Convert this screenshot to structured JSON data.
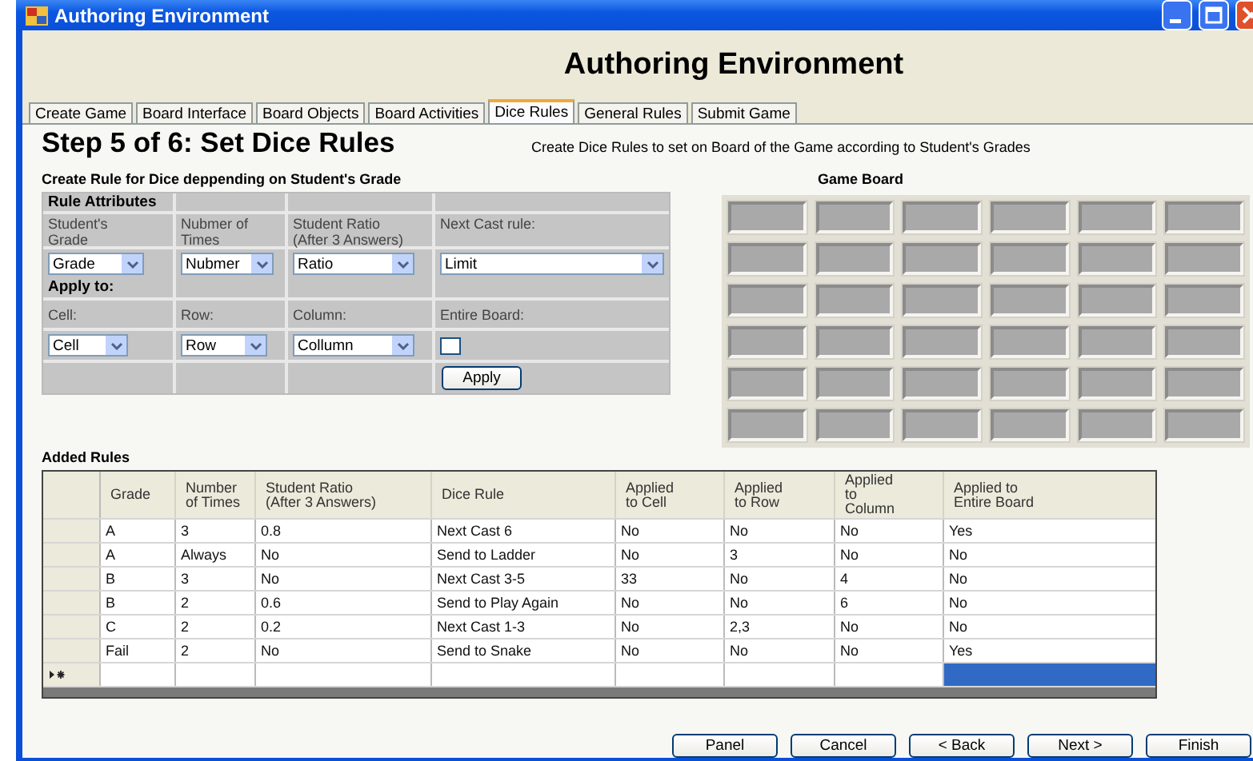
{
  "window": {
    "title": "Authoring Environment"
  },
  "header": "Authoring Environment",
  "tabs": [
    {
      "label": "Create Game",
      "selected": false
    },
    {
      "label": "Board Interface",
      "selected": false
    },
    {
      "label": "Board Objects",
      "selected": false
    },
    {
      "label": "Board Activities",
      "selected": false
    },
    {
      "label": "Dice Rules",
      "selected": true
    },
    {
      "label": "General Rules",
      "selected": false
    },
    {
      "label": "Submit Game",
      "selected": false
    }
  ],
  "step_title": "Step 5 of 6: Set Dice Rules",
  "description": "Create Dice Rules to set on Board of the Game according to Student's Grades",
  "rule_form": {
    "title": "Create Rule for Dice deppending on Student's Grade",
    "attributes_heading": "Rule Attributes",
    "attribute_labels": [
      "Student's\nGrade",
      "Nubmer of\nTimes",
      "Student Ratio\n(After 3 Answers)",
      "Next Cast rule:"
    ],
    "attribute_dropdowns": [
      "Grade",
      "Nubmer",
      "Ratio",
      "Limit"
    ],
    "apply_heading": "Apply to:",
    "apply_labels": [
      "Cell:",
      "Row:",
      "Column:",
      "Entire Board:"
    ],
    "apply_dropdowns": [
      "Cell",
      "Row",
      "Collumn"
    ],
    "entire_board_checked": false,
    "apply_button": "Apply"
  },
  "game_board": {
    "title": "Game Board"
  },
  "added_rules": {
    "title": "Added Rules",
    "columns": [
      "Grade",
      "Number\nof Times",
      "Student Ratio\n(After 3 Answers)",
      "Dice Rule",
      "Applied\nto Cell",
      "Applied\nto Row",
      "Applied\nto\nColumn",
      "Applied to\nEntire Board"
    ],
    "rows": [
      [
        "A",
        "3",
        "0.8",
        "Next Cast 6",
        "No",
        "No",
        "No",
        "Yes"
      ],
      [
        "A",
        "Always",
        "No",
        "Send to Ladder",
        "No",
        "3",
        "No",
        "No"
      ],
      [
        "B",
        "3",
        "No",
        "Next Cast 3-5",
        "33",
        "No",
        "4",
        "No"
      ],
      [
        "B",
        "2",
        "0.6",
        "Send to Play Again",
        "No",
        "No",
        "6",
        "No"
      ],
      [
        "C",
        "2",
        "0.2",
        "Next Cast 1-3",
        "No",
        "2,3",
        "No",
        "No"
      ],
      [
        "Fail",
        "2",
        "No",
        "Send to Snake",
        "No",
        "No",
        "No",
        "Yes"
      ]
    ],
    "new_row": [
      {
        "selected": false
      },
      {
        "selected": false
      },
      {
        "selected": false
      },
      {
        "selected": false
      },
      {
        "selected": false
      },
      {
        "selected": false
      },
      {
        "selected": false
      },
      {
        "selected": true
      }
    ]
  },
  "buttons": [
    "Panel",
    "Cancel",
    "< Back",
    "Next >",
    "Finish"
  ]
}
